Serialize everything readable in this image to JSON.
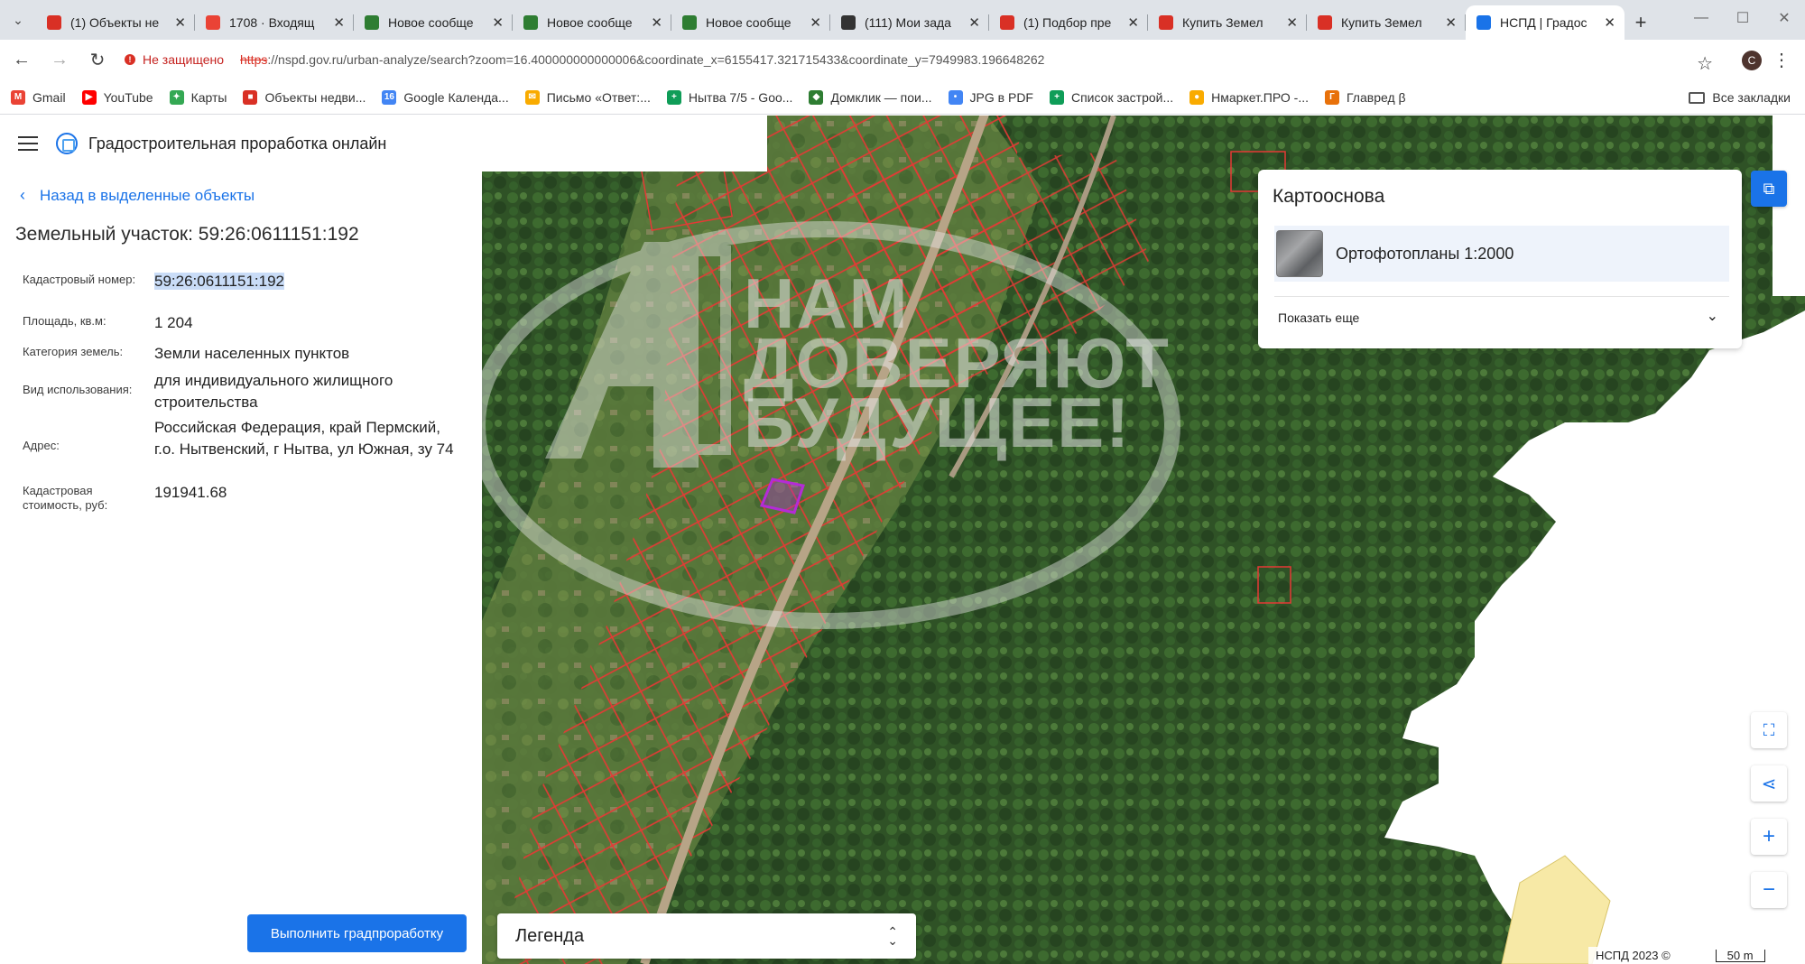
{
  "browser": {
    "tabs": [
      {
        "title": "(1) Объекты не",
        "favicon_color": "#d93025"
      },
      {
        "title": "1708 · Входящ",
        "favicon_color": "#ea4335"
      },
      {
        "title": "Новое сообще",
        "favicon_color": "#2e7d32"
      },
      {
        "title": "Новое сообще",
        "favicon_color": "#2e7d32"
      },
      {
        "title": "Новое сообще",
        "favicon_color": "#2e7d32"
      },
      {
        "title": "(111) Мои зада",
        "favicon_color": "#333333"
      },
      {
        "title": "(1) Подбор пре",
        "favicon_color": "#d93025"
      },
      {
        "title": "Купить Земел",
        "favicon_color": "#d93025"
      },
      {
        "title": "Купить Земел",
        "favicon_color": "#d93025"
      },
      {
        "title": "НСПД | Градос",
        "favicon_color": "#1a73e8",
        "active": true
      }
    ],
    "tab_close": "✕",
    "new_tab": "+",
    "security_label": "Не защищено",
    "url_proto": "https",
    "url_rest": "://nspd.gov.ru/urban-analyze/search?zoom=16.400000000000006&coordinate_x=6155417.321715433&coordinate_y=7949983.196648262",
    "profile_letter": "С",
    "bookmarks": [
      {
        "label": "Gmail",
        "color": "#ea4335",
        "glyph": "M"
      },
      {
        "label": "YouTube",
        "color": "#ff0000",
        "glyph": "▶"
      },
      {
        "label": "Карты",
        "color": "#34a853",
        "glyph": "✦"
      },
      {
        "label": "Объекты недви...",
        "color": "#d93025",
        "glyph": "■"
      },
      {
        "label": "Google Календа...",
        "color": "#4285f4",
        "glyph": "16"
      },
      {
        "label": "Письмо «Ответ:...",
        "color": "#f9ab00",
        "glyph": "✉"
      },
      {
        "label": "Нытва 7/5 - Goo...",
        "color": "#0f9d58",
        "glyph": "+"
      },
      {
        "label": "Домклик — пои...",
        "color": "#2e7d32",
        "glyph": "◆"
      },
      {
        "label": "JPG в PDF",
        "color": "#4285f4",
        "glyph": "•"
      },
      {
        "label": "Список застрой...",
        "color": "#0f9d58",
        "glyph": "+"
      },
      {
        "label": "Нмаркет.ПРО -...",
        "color": "#f9ab00",
        "glyph": "●"
      },
      {
        "label": "Главред β",
        "color": "#e8710a",
        "glyph": "Г"
      }
    ],
    "all_bookmarks": "Все закладки"
  },
  "app": {
    "title": "Градостроительная проработка онлайн",
    "back_label": "Назад в выделенные объекты",
    "object_title": "Земельный участок: 59:26:0611151:192",
    "properties": [
      {
        "label": "Кадастровый номер:",
        "value": "59:26:0611151:192"
      },
      {
        "label": "Площадь, кв.м:",
        "value": "1 204"
      },
      {
        "label": "Категория земель:",
        "value": "Земли населенных пунктов"
      },
      {
        "label": "Вид использования:",
        "value": "для индивидуального жилищного строительства"
      },
      {
        "label": "Адрес:",
        "value": "Российская Федерация, край Пермский, г.о. Нытвенский, г Нытва, ул Южная, зу 74"
      },
      {
        "label": "Кадастровая стоимость, руб:",
        "value": "191941.68"
      }
    ],
    "run_button": "Выполнить градпроработку"
  },
  "map": {
    "legend_label": "Легенда",
    "basemap": {
      "title": "Картооснова",
      "item": "Ортофотопланы 1:2000",
      "show_more": "Показать еще"
    },
    "watermark": [
      "НАМ",
      "ДОВЕРЯЮТ",
      "БУДУЩЕЕ!"
    ],
    "copyright": "НСПД 2023 ©",
    "scale_label": "50 m",
    "colors": {
      "parcel": "#e53935",
      "selected": "#b42bd6",
      "accent": "#1a73e8"
    }
  }
}
